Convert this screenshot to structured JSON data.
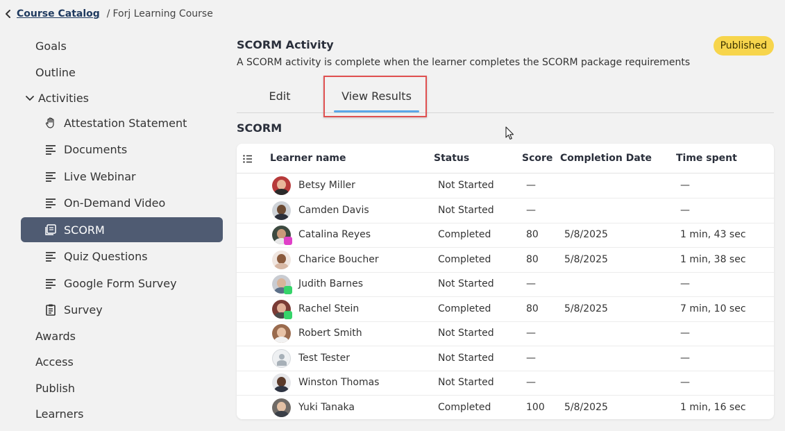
{
  "breadcrumb": {
    "back_link": "Course Catalog",
    "separator": "/",
    "current": "Forj Learning Course"
  },
  "sidebar": {
    "top_items": [
      {
        "label": "Goals"
      },
      {
        "label": "Outline"
      }
    ],
    "group_label": "Activities",
    "activities": [
      {
        "label": "Attestation Statement",
        "icon": "hand-icon"
      },
      {
        "label": "Documents",
        "icon": "lines-icon"
      },
      {
        "label": "Live Webinar",
        "icon": "lines-icon"
      },
      {
        "label": "On-Demand Video",
        "icon": "lines-icon"
      },
      {
        "label": "SCORM",
        "icon": "scorm-icon",
        "active": true
      },
      {
        "label": "Quiz Questions",
        "icon": "lines-icon"
      },
      {
        "label": "Google Form Survey",
        "icon": "lines-icon"
      },
      {
        "label": "Survey",
        "icon": "clipboard-icon"
      }
    ],
    "bottom_items": [
      {
        "label": "Awards"
      },
      {
        "label": "Access"
      },
      {
        "label": "Publish"
      },
      {
        "label": "Learners"
      }
    ]
  },
  "main": {
    "title": "SCORM Activity",
    "description": "A SCORM activity is complete when the learner completes the SCORM package requirements",
    "status_badge": "Published",
    "tabs": [
      {
        "label": "Edit"
      },
      {
        "label": "View Results",
        "active": true
      }
    ],
    "section_label": "SCORM",
    "table": {
      "columns": [
        "Learner name",
        "Status",
        "Score",
        "Completion Date",
        "Time spent"
      ],
      "rows": [
        {
          "name": "Betsy Miller",
          "status": "Not Started",
          "score": "—",
          "date": "",
          "time": "—"
        },
        {
          "name": "Camden Davis",
          "status": "Not Started",
          "score": "—",
          "date": "",
          "time": "—"
        },
        {
          "name": "Catalina Reyes",
          "status": "Completed",
          "score": "80",
          "date": "5/8/2025",
          "time": "1 min, 43 sec"
        },
        {
          "name": "Charice Boucher",
          "status": "Completed",
          "score": "80",
          "date": "5/8/2025",
          "time": "1 min, 38 sec"
        },
        {
          "name": "Judith Barnes",
          "status": "Not Started",
          "score": "—",
          "date": "",
          "time": "—"
        },
        {
          "name": "Rachel Stein",
          "status": "Completed",
          "score": "80",
          "date": "5/8/2025",
          "time": "7 min, 10 sec"
        },
        {
          "name": "Robert Smith",
          "status": "Not Started",
          "score": "—",
          "date": "",
          "time": "—"
        },
        {
          "name": "Test Tester",
          "status": "Not Started",
          "score": "—",
          "date": "",
          "time": "—"
        },
        {
          "name": "Winston Thomas",
          "status": "Not Started",
          "score": "—",
          "date": "",
          "time": "—"
        },
        {
          "name": "Yuki Tanaka",
          "status": "Completed",
          "score": "100",
          "date": "5/8/2025",
          "time": "1 min, 16 sec"
        }
      ]
    }
  },
  "colors": {
    "active_nav": "#4f5b72",
    "badge": "#f7d54c",
    "tab_underline": "#5aa7e8",
    "highlight": "#e05050"
  }
}
